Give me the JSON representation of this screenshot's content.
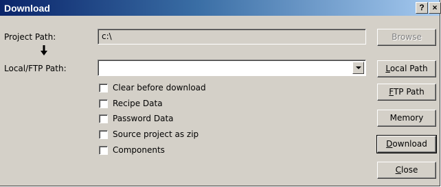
{
  "window": {
    "title": "Download",
    "help_label": "?",
    "close_label": "×"
  },
  "form": {
    "project_path_label": "Project Path:",
    "project_path_value": "c:\\",
    "local_path_label": "Local/FTP Path:",
    "local_path_value": ""
  },
  "checkboxes": [
    {
      "label": "Clear before download",
      "checked": false
    },
    {
      "label": "Recipe Data",
      "checked": false
    },
    {
      "label": "Password Data",
      "checked": false
    },
    {
      "label": "Source project as zip",
      "checked": false
    },
    {
      "label": "Components",
      "checked": false
    }
  ],
  "buttons": {
    "browse": {
      "first": "",
      "acc": "",
      "rest": "Browse",
      "enabled": false
    },
    "local_path": {
      "first": "",
      "acc": "L",
      "rest": "ocal Path"
    },
    "ftp_path": {
      "first": "",
      "acc": "F",
      "rest": "TP Path"
    },
    "memory": {
      "first": "",
      "acc": "",
      "rest": "Memory"
    },
    "download": {
      "first": "",
      "acc": "D",
      "rest": "ownload",
      "default": true
    },
    "close": {
      "first": "",
      "acc": "C",
      "rest": "lose"
    }
  },
  "icons": {
    "flow_arrow": "down-arrow-icon"
  }
}
